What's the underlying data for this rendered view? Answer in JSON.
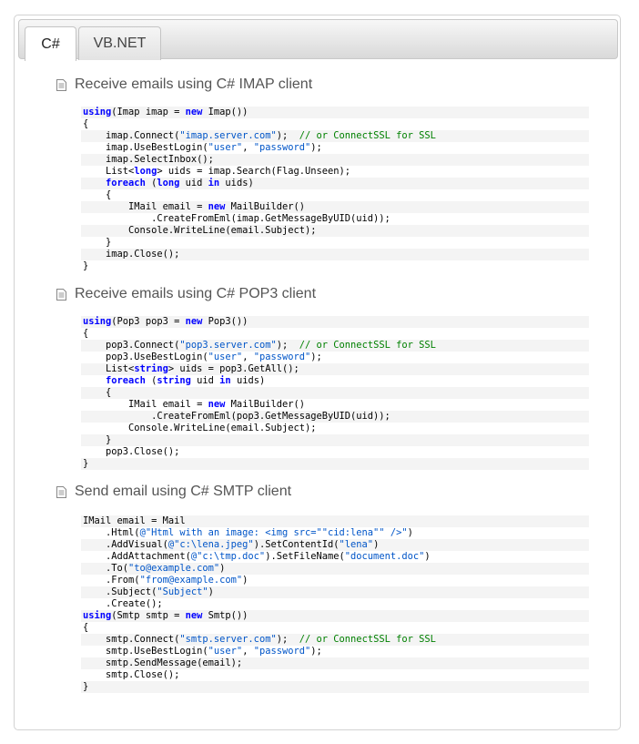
{
  "tabs": [
    {
      "label": "C#",
      "active": true
    },
    {
      "label": "VB.NET",
      "active": false
    }
  ],
  "sections": [
    {
      "title": "Receive emails using C# IMAP client",
      "lines": [
        [
          [
            "kw",
            "using"
          ],
          [
            "",
            "(Imap imap = "
          ],
          [
            "kw",
            "new"
          ],
          [
            "",
            " Imap())"
          ]
        ],
        [
          [
            "",
            "{"
          ]
        ],
        [
          [
            "",
            "    imap.Connect("
          ],
          [
            "st",
            "\"imap.server.com\""
          ],
          [
            "",
            ");  "
          ],
          [
            "cm",
            "// or ConnectSSL for SSL"
          ]
        ],
        [
          [
            "",
            "    imap.UseBestLogin("
          ],
          [
            "st",
            "\"user\""
          ],
          [
            "",
            ", "
          ],
          [
            "st",
            "\"password\""
          ],
          [
            "",
            ");"
          ]
        ],
        [
          [
            "",
            "    imap.SelectInbox();"
          ]
        ],
        [
          [
            "",
            "    List<"
          ],
          [
            "kw",
            "long"
          ],
          [
            "",
            "> uids = imap.Search(Flag.Unseen);"
          ]
        ],
        [
          [
            "",
            "    "
          ],
          [
            "kw",
            "foreach"
          ],
          [
            "",
            " ("
          ],
          [
            "kw",
            "long"
          ],
          [
            "",
            " uid "
          ],
          [
            "kw",
            "in"
          ],
          [
            "",
            " uids)"
          ]
        ],
        [
          [
            "",
            "    {"
          ]
        ],
        [
          [
            "",
            "        IMail email = "
          ],
          [
            "kw",
            "new"
          ],
          [
            "",
            " MailBuilder()"
          ]
        ],
        [
          [
            "",
            "            .CreateFromEml(imap.GetMessageByUID(uid));"
          ]
        ],
        [
          [
            "",
            "        Console.WriteLine(email.Subject);"
          ]
        ],
        [
          [
            "",
            "    }"
          ]
        ],
        [
          [
            "",
            "    imap.Close();"
          ]
        ],
        [
          [
            "",
            "}"
          ]
        ]
      ]
    },
    {
      "title": "Receive emails using C# POP3 client",
      "lines": [
        [
          [
            "kw",
            "using"
          ],
          [
            "",
            "(Pop3 pop3 = "
          ],
          [
            "kw",
            "new"
          ],
          [
            "",
            " Pop3())"
          ]
        ],
        [
          [
            "",
            "{"
          ]
        ],
        [
          [
            "",
            "    pop3.Connect("
          ],
          [
            "st",
            "\"pop3.server.com\""
          ],
          [
            "",
            ");  "
          ],
          [
            "cm",
            "// or ConnectSSL for SSL"
          ]
        ],
        [
          [
            "",
            "    pop3.UseBestLogin("
          ],
          [
            "st",
            "\"user\""
          ],
          [
            "",
            ", "
          ],
          [
            "st",
            "\"password\""
          ],
          [
            "",
            ");"
          ]
        ],
        [
          [
            "",
            "    List<"
          ],
          [
            "kw",
            "string"
          ],
          [
            "",
            "> uids = pop3.GetAll();"
          ]
        ],
        [
          [
            "",
            "    "
          ],
          [
            "kw",
            "foreach"
          ],
          [
            "",
            " ("
          ],
          [
            "kw",
            "string"
          ],
          [
            "",
            " uid "
          ],
          [
            "kw",
            "in"
          ],
          [
            "",
            " uids)"
          ]
        ],
        [
          [
            "",
            "    {"
          ]
        ],
        [
          [
            "",
            "        IMail email = "
          ],
          [
            "kw",
            "new"
          ],
          [
            "",
            " MailBuilder()"
          ]
        ],
        [
          [
            "",
            "            .CreateFromEml(pop3.GetMessageByUID(uid));"
          ]
        ],
        [
          [
            "",
            "        Console.WriteLine(email.Subject);"
          ]
        ],
        [
          [
            "",
            "    }"
          ]
        ],
        [
          [
            "",
            "    pop3.Close();"
          ]
        ],
        [
          [
            "",
            "}"
          ]
        ]
      ]
    },
    {
      "title": "Send email using C# SMTP client",
      "lines": [
        [
          [
            "",
            "IMail email = Mail"
          ]
        ],
        [
          [
            "",
            "    .Html("
          ],
          [
            "st",
            "@\"Html with an image: <img src=\"\"cid:lena\"\" />\""
          ],
          [
            "",
            ")"
          ]
        ],
        [
          [
            "",
            "    .AddVisual("
          ],
          [
            "st",
            "@\"c:\\lena.jpeg\""
          ],
          [
            "",
            ").SetContentId("
          ],
          [
            "st",
            "\"lena\""
          ],
          [
            "",
            ")"
          ]
        ],
        [
          [
            "",
            "    .AddAttachment("
          ],
          [
            "st",
            "@\"c:\\tmp.doc\""
          ],
          [
            "",
            ").SetFileName("
          ],
          [
            "st",
            "\"document.doc\""
          ],
          [
            "",
            ")"
          ]
        ],
        [
          [
            "",
            "    .To("
          ],
          [
            "st",
            "\"to@example.com\""
          ],
          [
            "",
            ")"
          ]
        ],
        [
          [
            "",
            "    .From("
          ],
          [
            "st",
            "\"from@example.com\""
          ],
          [
            "",
            ")"
          ]
        ],
        [
          [
            "",
            "    .Subject("
          ],
          [
            "st",
            "\"Subject\""
          ],
          [
            "",
            ")"
          ]
        ],
        [
          [
            "",
            "    .Create();"
          ]
        ],
        [
          [
            "kw",
            "using"
          ],
          [
            "",
            "(Smtp smtp = "
          ],
          [
            "kw",
            "new"
          ],
          [
            "",
            " Smtp())"
          ]
        ],
        [
          [
            "",
            "{"
          ]
        ],
        [
          [
            "",
            "    smtp.Connect("
          ],
          [
            "st",
            "\"smtp.server.com\""
          ],
          [
            "",
            ");  "
          ],
          [
            "cm",
            "// or ConnectSSL for SSL"
          ]
        ],
        [
          [
            "",
            "    smtp.UseBestLogin("
          ],
          [
            "st",
            "\"user\""
          ],
          [
            "",
            ", "
          ],
          [
            "st",
            "\"password\""
          ],
          [
            "",
            ");"
          ]
        ],
        [
          [
            "",
            "    smtp.SendMessage(email);"
          ]
        ],
        [
          [
            "",
            "    smtp.Close();"
          ]
        ],
        [
          [
            "",
            "}"
          ]
        ]
      ]
    }
  ]
}
